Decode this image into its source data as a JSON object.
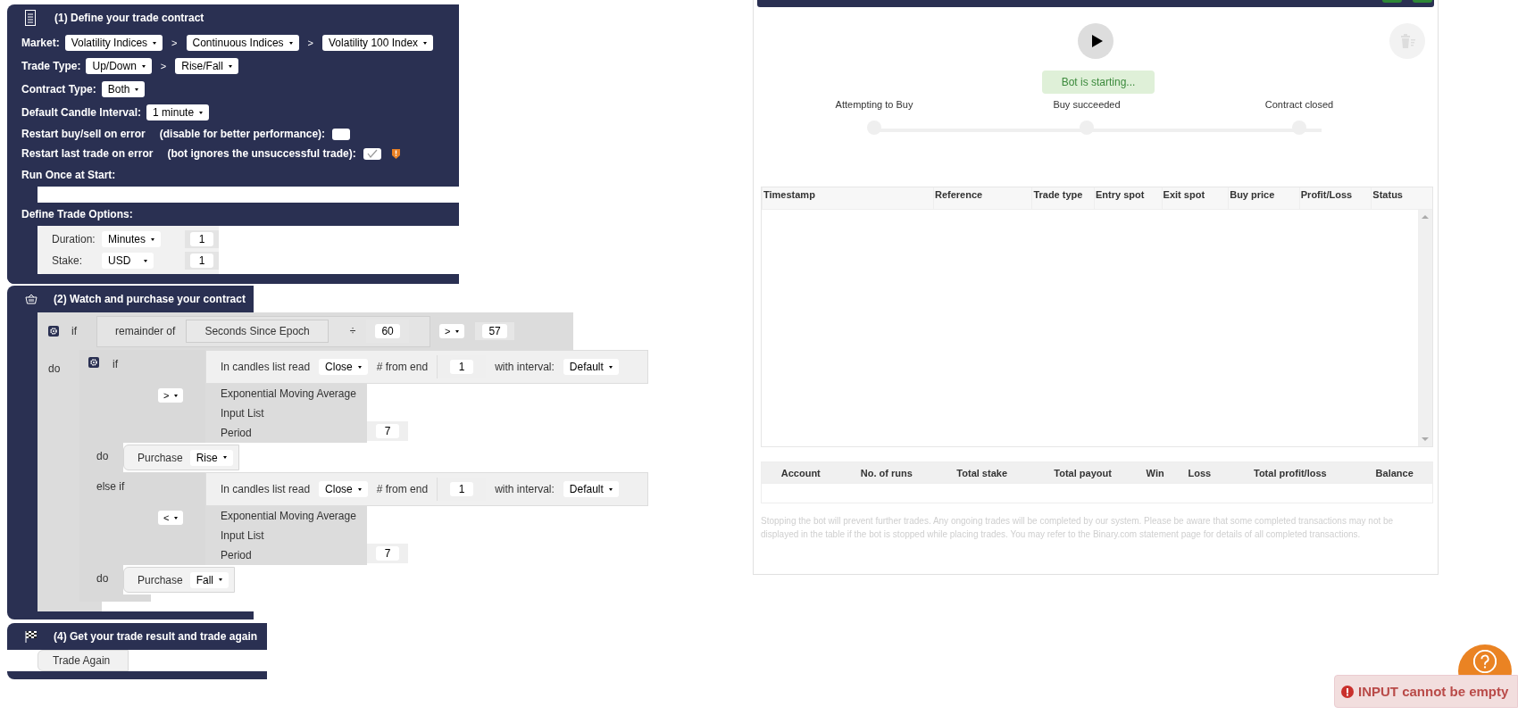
{
  "contract_block": {
    "title": "(1) Define your trade contract",
    "market": {
      "label": "Market:",
      "separator": ">",
      "options": [
        "Volatility Indices",
        "Continuous Indices",
        "Volatility 100 Index"
      ]
    },
    "trade_type": {
      "label": "Trade Type:",
      "separator": ">",
      "options": [
        "Up/Down",
        "Rise/Fall"
      ]
    },
    "contract_type": {
      "label": "Contract Type:",
      "value": "Both"
    },
    "candle_interval": {
      "label": "Default Candle Interval:",
      "value": "1 minute"
    },
    "restart_buy_sell": {
      "label": "Restart buy/sell on error",
      "hint": "(disable for better performance):",
      "checked": false
    },
    "restart_last_trade": {
      "label": "Restart last trade on error",
      "hint": "(bot ignores the unsuccessful trade):",
      "checked": true,
      "warning": true
    },
    "run_once_label": "Run Once at Start:",
    "trade_options": {
      "label": "Define Trade Options:",
      "rows": [
        {
          "label": "Duration:",
          "unit": "Minutes",
          "value": "1"
        },
        {
          "label": "Stake:",
          "unit": "USD",
          "value": "1"
        }
      ]
    }
  },
  "watch_block": {
    "title": "(2) Watch and purchase your contract",
    "if_label": "if",
    "do_label": "do",
    "condition": {
      "label": "remainder of",
      "operand": "Seconds Since Epoch",
      "operator": "÷",
      "divisor": "60",
      "compare": ">",
      "value": "57"
    },
    "inner_if": {
      "branches": [
        {
          "label": "if",
          "gear": true,
          "compare": ">",
          "candle": {
            "label": "In candles list read",
            "field": "Close",
            "from_end_label": "# from end",
            "from_end": "1",
            "interval_label": "with interval:",
            "interval": "Default"
          },
          "ema": {
            "title": "Exponential Moving Average",
            "input_label": "Input List",
            "period_label": "Period",
            "period": "7"
          },
          "do_label": "do",
          "purchase_label": "Purchase",
          "purchase": "Rise"
        },
        {
          "label": "else if",
          "gear": false,
          "compare": "<",
          "candle": {
            "label": "In candles list read",
            "field": "Close",
            "from_end_label": "# from end",
            "from_end": "1",
            "interval_label": "with interval:",
            "interval": "Default"
          },
          "ema": {
            "title": "Exponential Moving Average",
            "input_label": "Input List",
            "period_label": "Period",
            "period": "7"
          },
          "do_label": "do",
          "purchase_label": "Purchase",
          "purchase": "Fall"
        }
      ]
    }
  },
  "result_block": {
    "title": "(4) Get your trade result and trade again",
    "action": "Trade Again"
  },
  "panel": {
    "status": "Bot is starting...",
    "steps": [
      {
        "label": "Attempting to Buy"
      },
      {
        "label": "Buy succeeded"
      },
      {
        "label": "Contract closed"
      }
    ],
    "table": {
      "columns": [
        "Timestamp",
        "Reference",
        "Trade type",
        "Entry spot",
        "Exit spot",
        "Buy price",
        "Profit/Loss",
        "Status"
      ]
    },
    "summary": {
      "columns": [
        "Account",
        "No. of runs",
        "Total stake",
        "Total payout",
        "Win",
        "Loss",
        "Total profit/loss",
        "Balance"
      ]
    },
    "notice": "Stopping the bot will prevent further trades. Any ongoing trades will be completed by our system. Please be aware that some completed transactions may not be displayed in the table if the bot is stopped while placing trades. You may refer to the Binary.com statement page for details of all completed transactions."
  },
  "toast": {
    "message": "INPUT cannot be empty"
  }
}
